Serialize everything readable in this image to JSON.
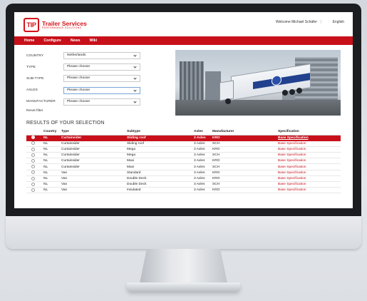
{
  "brand": {
    "logo_badge": "TIP",
    "title": "Trailer Services",
    "subtitle": "PERFORMANCE SOLUTIONS",
    "accent": "#c8101a"
  },
  "header": {
    "welcome": "Welcome Michael Schäfer",
    "separator": "|",
    "language": "English"
  },
  "nav": [
    {
      "label": "Home"
    },
    {
      "label": "Configure"
    },
    {
      "label": "News"
    },
    {
      "label": "Wiki"
    }
  ],
  "filters": [
    {
      "label": "COUNTRY",
      "value": "Netherlands"
    },
    {
      "label": "TYPE",
      "value": "Please choose"
    },
    {
      "label": "SUB-TYPE",
      "value": "Please choose"
    },
    {
      "label": "AXLES",
      "value": "Please choose"
    },
    {
      "label": "MANUFACTURER",
      "value": "Please choose"
    }
  ],
  "reset_label": "Reset filter",
  "results": {
    "title": "RESULTS OF YOUR SELECTION",
    "columns": [
      "",
      "Country",
      "Type",
      "Subtype",
      "Axles",
      "Manufacturer",
      "Specification"
    ],
    "rows": [
      {
        "country": "NL",
        "type": "Curtainsider",
        "subtype": "Sliding roof",
        "axles": "3 Axles",
        "manufacturer": "KRO",
        "spec": "Base Specification",
        "selected": true
      },
      {
        "country": "NL",
        "type": "Curtainsider",
        "subtype": "Sliding roof",
        "axles": "3 Axles",
        "manufacturer": "SCH",
        "spec": "Base Specification",
        "selected": false
      },
      {
        "country": "NL",
        "type": "Curtainsider",
        "subtype": "Mega",
        "axles": "3 Axles",
        "manufacturer": "KRO",
        "spec": "Base Specification",
        "selected": false
      },
      {
        "country": "NL",
        "type": "Curtainsider",
        "subtype": "Mega",
        "axles": "3 Axles",
        "manufacturer": "SCH",
        "spec": "Base Specification",
        "selected": false
      },
      {
        "country": "NL",
        "type": "Curtainsider",
        "subtype": "Maxi",
        "axles": "3 Axles",
        "manufacturer": "KRO",
        "spec": "Base Specification",
        "selected": false
      },
      {
        "country": "NL",
        "type": "Curtainsider",
        "subtype": "Maxi",
        "axles": "3 Axles",
        "manufacturer": "SCH",
        "spec": "Base Specification",
        "selected": false
      },
      {
        "country": "NL",
        "type": "Van",
        "subtype": "Standard",
        "axles": "3 Axles",
        "manufacturer": "KRO",
        "spec": "Base Specification",
        "selected": false
      },
      {
        "country": "NL",
        "type": "Van",
        "subtype": "Double Deck",
        "axles": "3 Axles",
        "manufacturer": "KRO",
        "spec": "Base Specification",
        "selected": false
      },
      {
        "country": "NL",
        "type": "Van",
        "subtype": "Double Deck",
        "axles": "3 Axles",
        "manufacturer": "SCH",
        "spec": "Base Specification",
        "selected": false
      },
      {
        "country": "NL",
        "type": "Van",
        "subtype": "Insulated",
        "axles": "3 Axles",
        "manufacturer": "KRO",
        "spec": "Base Specification",
        "selected": false
      }
    ]
  }
}
